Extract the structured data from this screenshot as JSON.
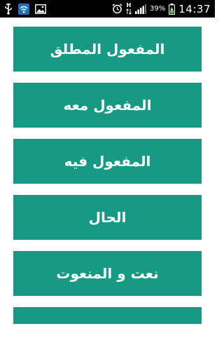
{
  "status_bar": {
    "battery_percent": "39%",
    "time": "14:37",
    "network_type": "H",
    "icons": [
      "usb-icon",
      "wifi-icon",
      "image-icon",
      "alarm-icon",
      "data-arrows-icon",
      "signal-icon",
      "battery-charging-icon"
    ]
  },
  "menu": {
    "items": [
      {
        "label": "المفعول المطلق"
      },
      {
        "label": "المفعول معه"
      },
      {
        "label": "المفعول فيه"
      },
      {
        "label": "الحال"
      },
      {
        "label": "نعت و المنعوت"
      },
      {
        "label": ""
      }
    ]
  },
  "colors": {
    "button_bg": "#169a86",
    "button_text": "#ffffff",
    "status_bar_bg": "#000000",
    "page_bg": "#ffffff",
    "battery_green": "#4caf50"
  }
}
